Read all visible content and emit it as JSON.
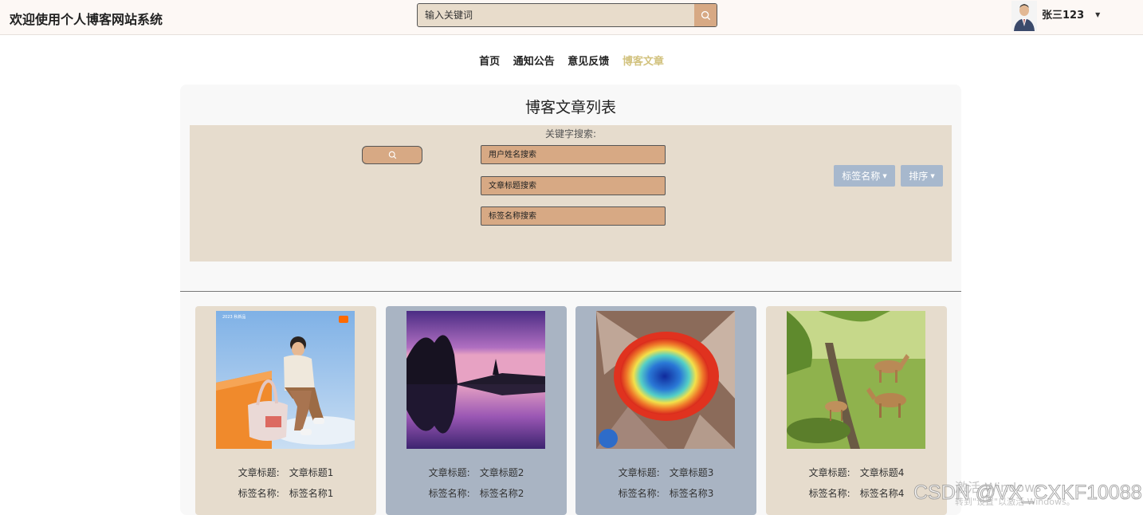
{
  "header": {
    "site_title": "欢迎使用个人博客网站系统",
    "search_placeholder": "输入关键词",
    "user_name": "张三123"
  },
  "nav": {
    "items": [
      {
        "label": "首页"
      },
      {
        "label": "通知公告"
      },
      {
        "label": "意见反馈"
      },
      {
        "label": "博客文章"
      }
    ]
  },
  "panel": {
    "title": "博客文章列表",
    "filter_label": "关键字搜索:",
    "fields": [
      {
        "placeholder": "用户姓名搜索"
      },
      {
        "placeholder": "文章标题搜索"
      },
      {
        "placeholder": "标签名称搜索"
      }
    ],
    "dropdowns": [
      {
        "label": "标签名称"
      },
      {
        "label": "排序"
      }
    ]
  },
  "cards": [
    {
      "title_key": "文章标题:",
      "title": "文章标题1",
      "tag_key": "标签名称:",
      "tag": "标签名称1",
      "bg": "#e6dccd"
    },
    {
      "title_key": "文章标题:",
      "title": "文章标题2",
      "tag_key": "标签名称:",
      "tag": "标签名称2",
      "bg": "#a9b4c3"
    },
    {
      "title_key": "文章标题:",
      "title": "文章标题3",
      "tag_key": "标签名称:",
      "tag": "标签名称3",
      "bg": "#a9b4c3"
    },
    {
      "title_key": "文章标题:",
      "title": "文章标题4",
      "tag_key": "标签名称:",
      "tag": "标签名称4",
      "bg": "#e6dccd"
    }
  ],
  "overlay": {
    "activation_title": "激活 Windows",
    "activation_sub": "转到\"设置\"以激活 Windows。",
    "csdn_watermark": "CSDN @VX_CXKF10088"
  },
  "colors": {
    "accent_nav": "#d2c27e",
    "search_btn": "#d7a984",
    "filter_bg": "#e6dccd",
    "dropdown_bg": "#a7b8cd"
  },
  "icons": {
    "search": "search-icon",
    "caret": "caret-down-icon"
  }
}
